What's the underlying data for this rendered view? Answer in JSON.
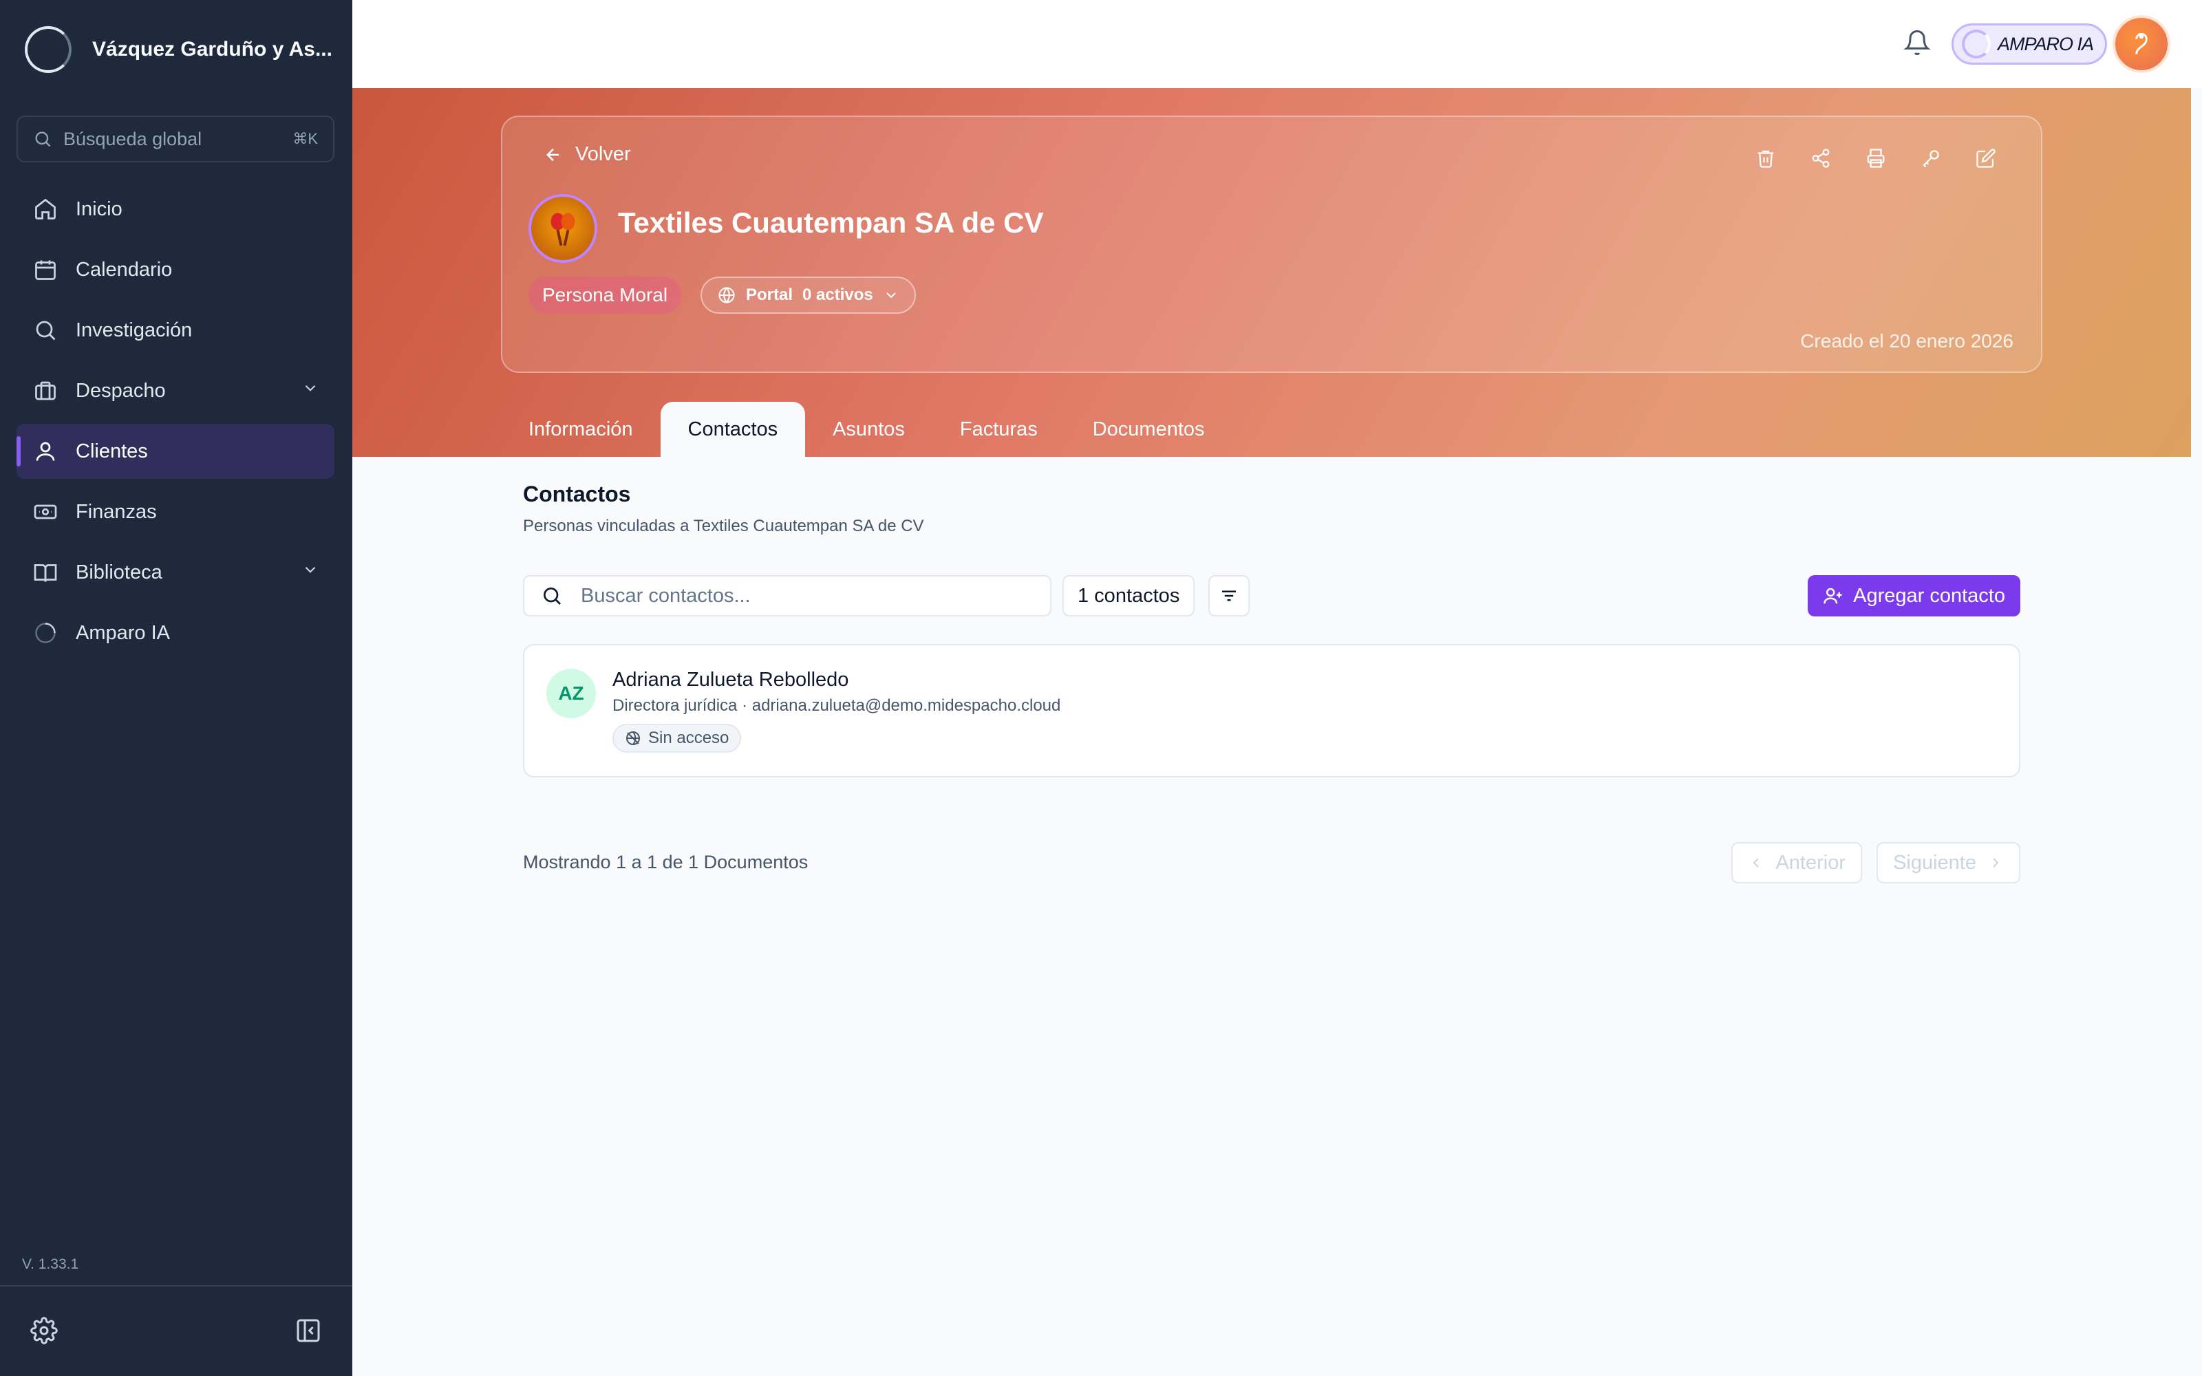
{
  "sidebar": {
    "org_name": "Vázquez Garduño y As...",
    "search": {
      "placeholder": "Búsqueda global",
      "shortcut": "⌘K"
    },
    "items": [
      {
        "label": "Inicio",
        "icon": "home-icon"
      },
      {
        "label": "Calendario",
        "icon": "calendar-icon"
      },
      {
        "label": "Investigación",
        "icon": "search-icon"
      },
      {
        "label": "Despacho",
        "icon": "briefcase-icon",
        "expandable": true
      },
      {
        "label": "Clientes",
        "icon": "user-icon",
        "active": true
      },
      {
        "label": "Finanzas",
        "icon": "banknote-icon"
      },
      {
        "label": "Biblioteca",
        "icon": "book-icon",
        "expandable": true
      },
      {
        "label": "Amparo IA",
        "icon": "spinner-icon"
      }
    ],
    "version": "V. 1.33.1"
  },
  "topbar": {
    "assistant_label": "AMPARO IA"
  },
  "hero": {
    "back_label": "Volver",
    "client_name": "Textiles Cuautempan SA de CV",
    "type_badge": "Persona Moral",
    "portal_label": "Portal",
    "portal_active": "0 activos",
    "created": "Creado el 20 enero 2026",
    "tabs": [
      "Información",
      "Contactos",
      "Asuntos",
      "Facturas",
      "Documentos"
    ],
    "active_tab": "Contactos"
  },
  "contacts": {
    "title": "Contactos",
    "subtitle": "Personas vinculadas a Textiles Cuautempan SA de CV",
    "search_placeholder": "Buscar contactos...",
    "count_label": "1 contactos",
    "add_label": "Agregar contacto",
    "items": [
      {
        "initials": "AZ",
        "name": "Adriana Zulueta Rebolledo",
        "meta": "Directora jurídica · adriana.zulueta@demo.midespacho.cloud",
        "access": "Sin acceso"
      }
    ]
  },
  "pagination": {
    "showing": "Mostrando 1 a 1 de 1 Documentos",
    "prev": "Anterior",
    "next": "Siguiente"
  },
  "colors": {
    "sidebar_bg": "#1e293b",
    "accent": "#7c3aed",
    "hero_start": "#c9573c",
    "hero_end": "#dca15d"
  }
}
